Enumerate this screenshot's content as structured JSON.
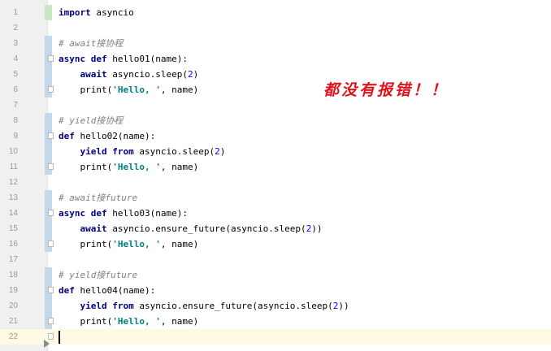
{
  "editor": {
    "lines": [
      {
        "n": "1",
        "t": [
          [
            "kw",
            "import"
          ],
          [
            "",
            " asyncio"
          ]
        ]
      },
      {
        "n": "2",
        "t": []
      },
      {
        "n": "3",
        "t": [
          [
            "cm",
            "# await接协程"
          ]
        ]
      },
      {
        "n": "4",
        "t": [
          [
            "kw",
            "async def"
          ],
          [
            "",
            " hello01(name):"
          ]
        ]
      },
      {
        "n": "5",
        "t": [
          [
            "",
            "    "
          ],
          [
            "kw",
            "await"
          ],
          [
            "",
            " asyncio.sleep("
          ],
          [
            "nm",
            "2"
          ],
          [
            "",
            ")"
          ]
        ]
      },
      {
        "n": "6",
        "t": [
          [
            "",
            "    print("
          ],
          [
            "st",
            "'Hello, '"
          ],
          [
            "",
            ", name)"
          ]
        ]
      },
      {
        "n": "7",
        "t": []
      },
      {
        "n": "8",
        "t": [
          [
            "cm",
            "# yield接协程"
          ]
        ]
      },
      {
        "n": "9",
        "t": [
          [
            "kw",
            "def"
          ],
          [
            "",
            " hello02(name):"
          ]
        ]
      },
      {
        "n": "10",
        "t": [
          [
            "",
            "    "
          ],
          [
            "kw",
            "yield from"
          ],
          [
            "",
            " asyncio.sleep("
          ],
          [
            "nm",
            "2"
          ],
          [
            "",
            ")"
          ]
        ]
      },
      {
        "n": "11",
        "t": [
          [
            "",
            "    print("
          ],
          [
            "st",
            "'Hello, '"
          ],
          [
            "",
            ", name)"
          ]
        ]
      },
      {
        "n": "12",
        "t": []
      },
      {
        "n": "13",
        "t": [
          [
            "cm",
            "# await接future"
          ]
        ]
      },
      {
        "n": "14",
        "t": [
          [
            "kw",
            "async def"
          ],
          [
            "",
            " hello03(name):"
          ]
        ]
      },
      {
        "n": "15",
        "t": [
          [
            "",
            "    "
          ],
          [
            "kw",
            "await"
          ],
          [
            "",
            " asyncio.ensure_future(asyncio.sleep("
          ],
          [
            "nm",
            "2"
          ],
          [
            "",
            "))"
          ]
        ]
      },
      {
        "n": "16",
        "t": [
          [
            "",
            "    print("
          ],
          [
            "st",
            "'Hello, '"
          ],
          [
            "",
            ", name)"
          ]
        ]
      },
      {
        "n": "17",
        "t": []
      },
      {
        "n": "18",
        "t": [
          [
            "cm",
            "# yield接future"
          ]
        ]
      },
      {
        "n": "19",
        "t": [
          [
            "kw",
            "def"
          ],
          [
            "",
            " hello04(name):"
          ]
        ]
      },
      {
        "n": "20",
        "t": [
          [
            "",
            "    "
          ],
          [
            "kw",
            "yield from"
          ],
          [
            "",
            " asyncio.ensure_future(asyncio.sleep("
          ],
          [
            "nm",
            "2"
          ],
          [
            "",
            "))"
          ]
        ]
      },
      {
        "n": "21",
        "t": [
          [
            "",
            "    print("
          ],
          [
            "st",
            "'Hello, '"
          ],
          [
            "",
            ", name)"
          ]
        ]
      },
      {
        "n": "22",
        "t": []
      }
    ],
    "current_line": "22",
    "annotation": "都没有报错！！",
    "colors": {
      "keyword": "#000080",
      "comment": "#808080",
      "string": "#008080",
      "number": "#0000ff",
      "annotation": "#e0131c",
      "current_line_bg": "#fffae3"
    }
  }
}
